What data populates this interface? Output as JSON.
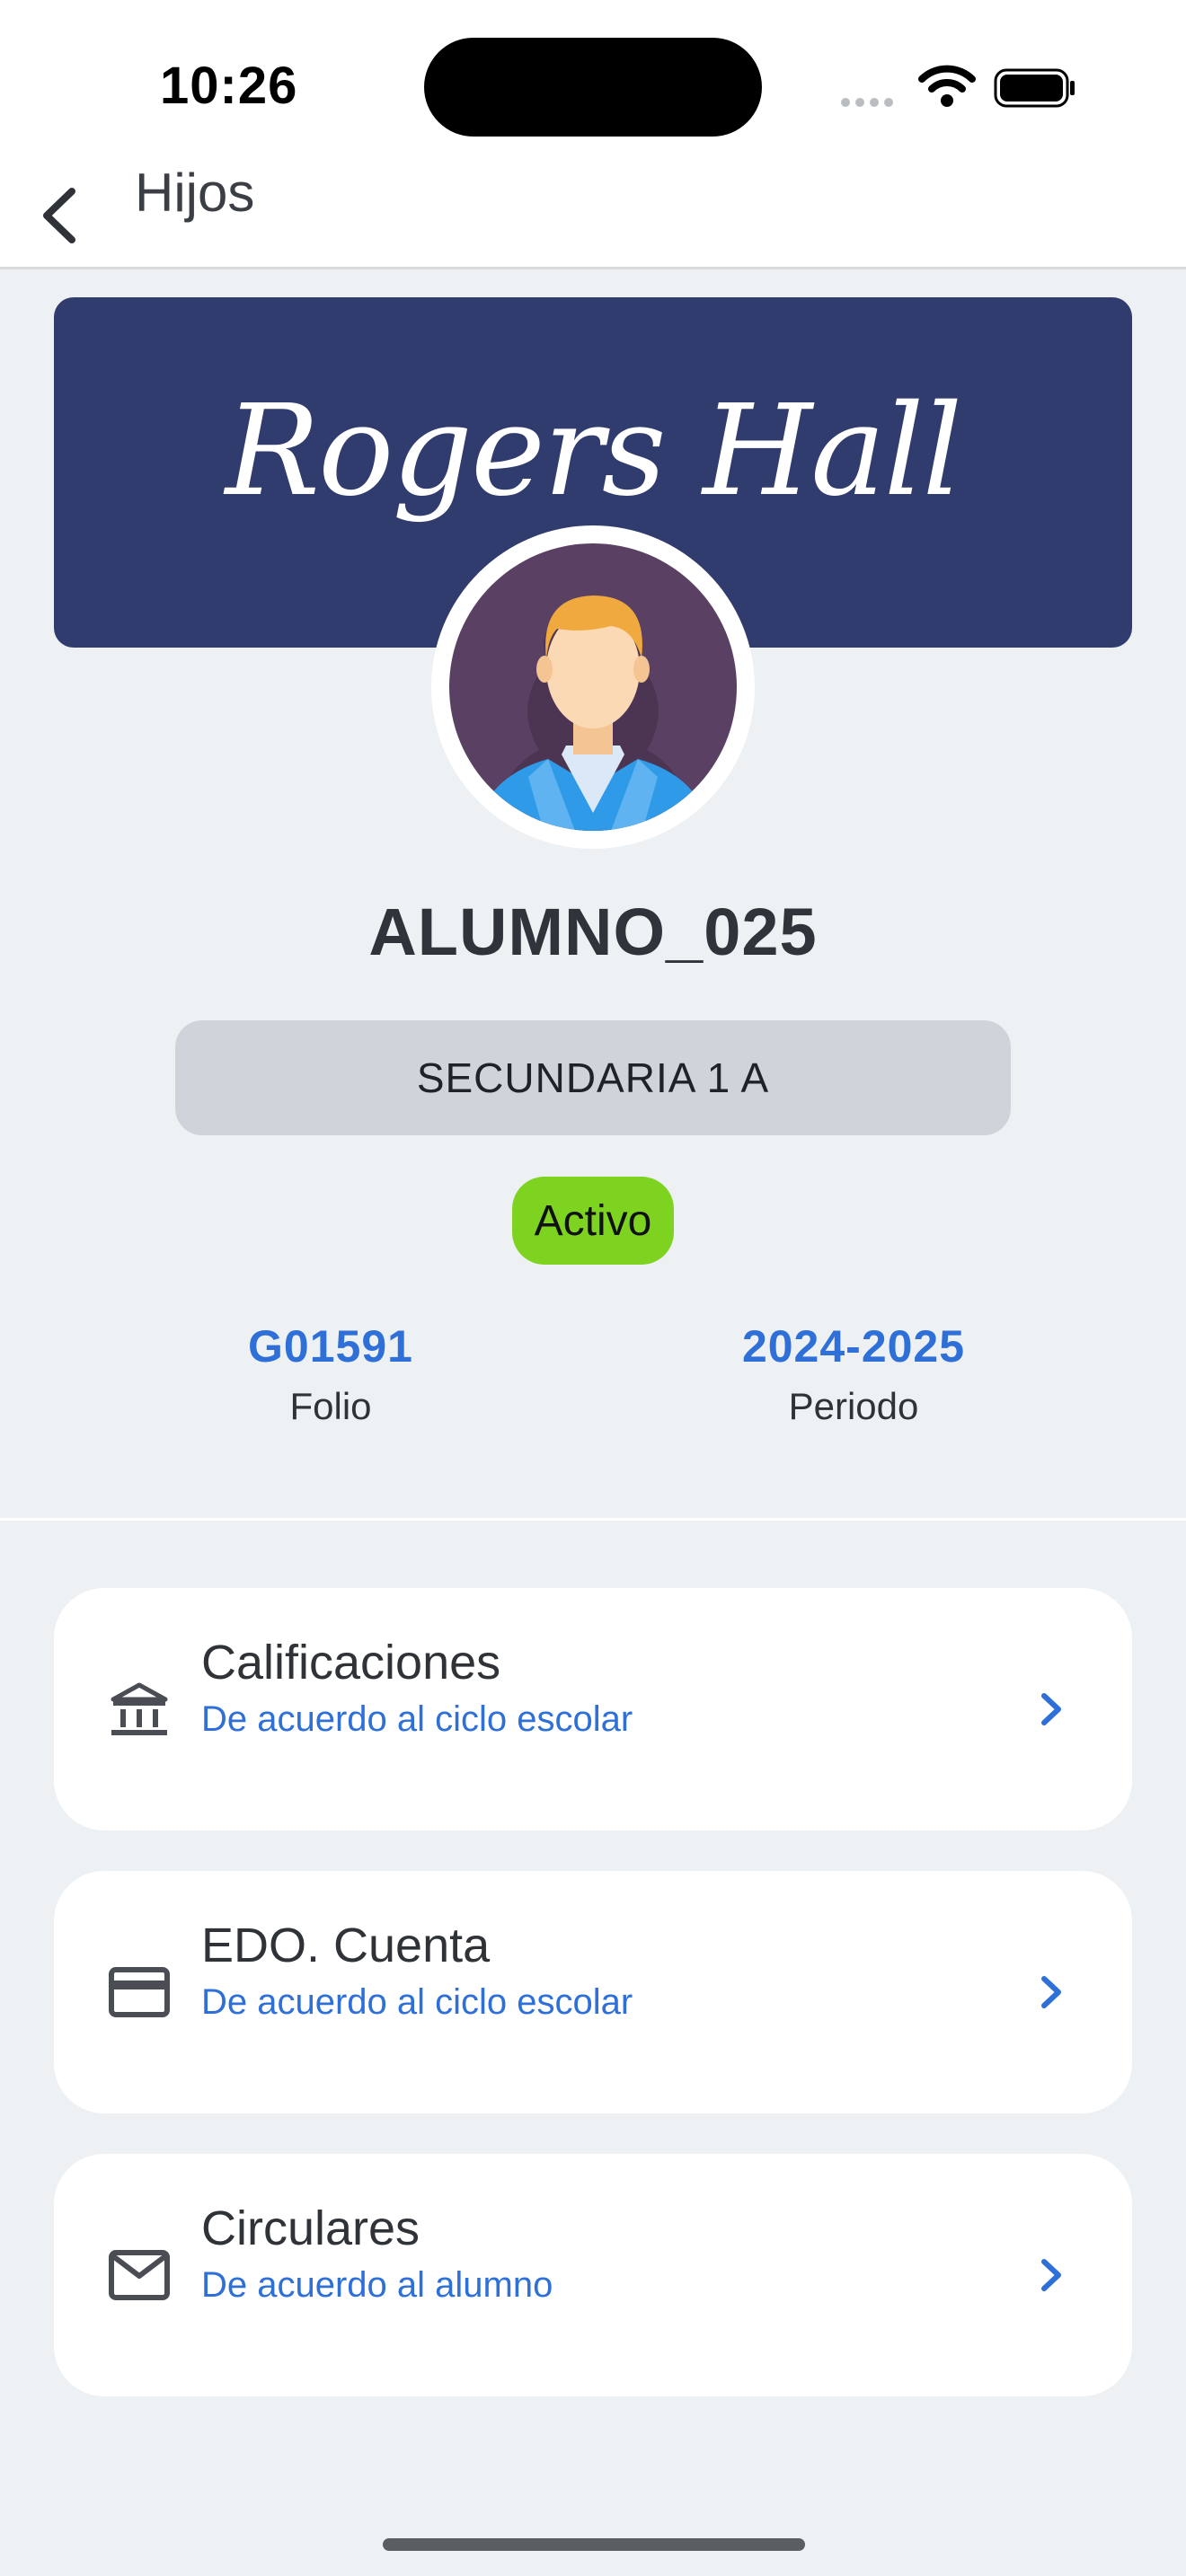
{
  "status_bar": {
    "time": "10:26"
  },
  "nav": {
    "title": "Hijos"
  },
  "banner": {
    "logo_text": "Rogers Hall",
    "color": "#303b6e"
  },
  "student": {
    "name": "ALUMNO_025",
    "grade": "SECUNDARIA  1  A",
    "status": "Activo",
    "status_color": "#7ed321",
    "folio": {
      "value": "G01591",
      "label": "Folio"
    },
    "period": {
      "value": "2024-2025",
      "label": "Periodo"
    }
  },
  "menu": [
    {
      "title": "Calificaciones",
      "subtitle": "De acuerdo al ciclo escolar",
      "icon": "bank-icon"
    },
    {
      "title": "EDO. Cuenta",
      "subtitle": "De acuerdo al ciclo escolar",
      "icon": "credit-card-icon"
    },
    {
      "title": "Circulares",
      "subtitle": "De acuerdo al alumno",
      "icon": "mail-icon"
    }
  ],
  "colors": {
    "accent": "#2f6fd8",
    "background": "#eef1f4"
  }
}
